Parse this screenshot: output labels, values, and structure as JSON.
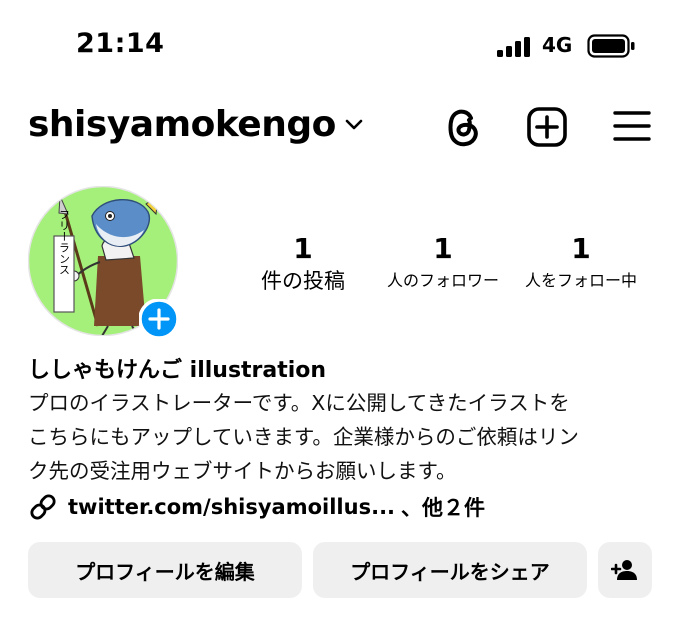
{
  "status_bar": {
    "time": "21:14",
    "network": "4G",
    "icons": [
      "signal-bars-icon",
      "battery-icon"
    ]
  },
  "header": {
    "username": "shisyamokengo",
    "icons": [
      "chevron-down-icon",
      "threads-icon",
      "new-post-icon",
      "menu-icon"
    ]
  },
  "profile": {
    "avatar_text": "フリーランス",
    "stats": [
      {
        "value": "1",
        "label": "件の投稿"
      },
      {
        "value": "1",
        "label": "人のフォロワー"
      },
      {
        "value": "1",
        "label": "人をフォロー中"
      }
    ],
    "display_name": "ししゃもけんご illustration",
    "bio_lines": [
      "プロのイラストレーターです。Xに公開してきたイラストを",
      "こちらにもアップしていきます。企業様からのご依頼はリン",
      "ク先の受注用ウェブサイトからお願いします。"
    ],
    "link_text": "twitter.com/shisyamoillus...",
    "link_more": "、他２件"
  },
  "actions": {
    "edit_label": "プロフィールを編集",
    "share_label": "プロフィールをシェア"
  },
  "colors": {
    "accent_blue": "#0095f6",
    "button_bg": "#efefef",
    "avatar_bg": "#a5f07a"
  }
}
